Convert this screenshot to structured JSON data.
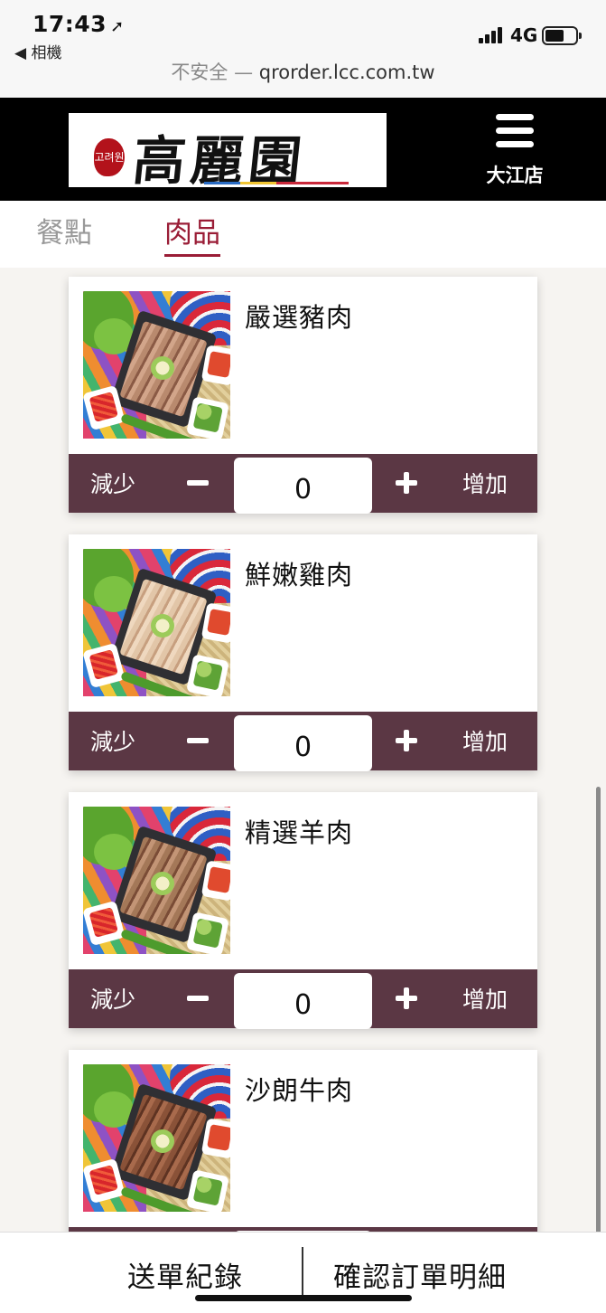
{
  "status_bar": {
    "time": "17:43",
    "back_app": "◀ 相機",
    "network": "4G"
  },
  "address_bar": {
    "security": "不安全 — ",
    "host": "qrorder.lcc.com.tw"
  },
  "header": {
    "brand": "高麗園",
    "seal_text": "고려원",
    "branch": "大江店",
    "menu_icon": "hamburger-icon"
  },
  "tabs": [
    {
      "label": "餐點",
      "active": false
    },
    {
      "label": "肉品",
      "active": true
    }
  ],
  "items": [
    {
      "name": "嚴選豬肉",
      "quantity": "0"
    },
    {
      "name": "鮮嫩雞肉",
      "quantity": "0"
    },
    {
      "name": "精選羊肉",
      "quantity": "0"
    },
    {
      "name": "沙朗牛肉",
      "quantity": "0"
    }
  ],
  "quantity_controls": {
    "decrease_label": "減少",
    "increase_label": "增加"
  },
  "bottom_bar": {
    "history_label": "送單紀錄",
    "confirm_label": "確認訂單明細"
  },
  "colors": {
    "header_bg": "#000000",
    "accent": "#9a1d36",
    "qty_bar": "#5b3744",
    "page_bg": "#f6f4f1"
  }
}
